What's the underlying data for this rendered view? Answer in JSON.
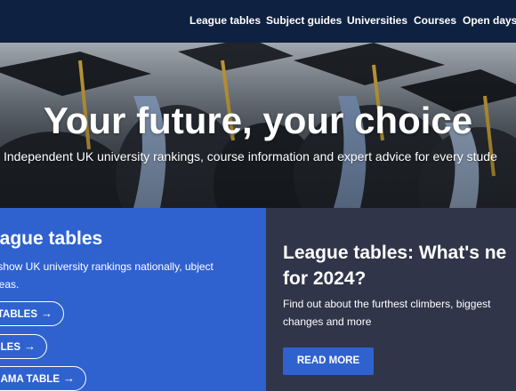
{
  "nav": {
    "items": [
      "League tables",
      "Subject guides",
      "Universities",
      "Courses",
      "Open days"
    ]
  },
  "hero": {
    "title": "Your future, your choice",
    "subtitle": "Independent UK university rankings, course information and expert advice for every stude"
  },
  "league_panel": {
    "title": "eague tables",
    "description": "s show UK university rankings nationally, ubject areas.",
    "buttons": [
      "TABLES",
      "BLES",
      "AMA TABLE"
    ]
  },
  "news_panel": {
    "title_line1": "League tables: What's ne",
    "title_line2": "for 2024?",
    "desc_line1": "Find out about the furthest climbers, biggest",
    "desc_line2": "changes and more",
    "cta": "READ MORE"
  },
  "colors": {
    "topbar": "#0f2140",
    "blue_panel": "#2f62cf",
    "dark_panel": "#303549"
  }
}
